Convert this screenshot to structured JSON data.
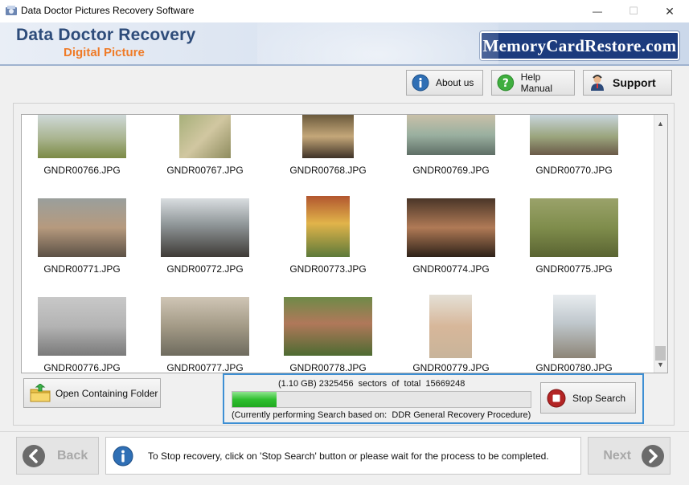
{
  "window": {
    "title": "Data Doctor Pictures Recovery Software",
    "minimize_glyph": "—",
    "maximize_glyph": "☐",
    "close_glyph": "✕"
  },
  "header": {
    "brand_main": "Data Doctor Recovery",
    "brand_sub": "Digital Picture",
    "site": "MemoryCardRestore.com",
    "colors": {
      "brand_blue": "#2e4c7a",
      "brand_orange": "#ef7b28",
      "badge_bg": "#1c3b7d"
    }
  },
  "toolbar": {
    "about_label": "About us",
    "help_label": "Help Manual",
    "support_label": "Support"
  },
  "gallery": {
    "items": [
      "GNDR00766.JPG",
      "GNDR00767.JPG",
      "GNDR00768.JPG",
      "GNDR00769.JPG",
      "GNDR00770.JPG",
      "GNDR00771.JPG",
      "GNDR00772.JPG",
      "GNDR00773.JPG",
      "GNDR00774.JPG",
      "GNDR00775.JPG",
      "GNDR00776.JPG",
      "GNDR00777.JPG",
      "GNDR00778.JPG",
      "GNDR00779.JPG",
      "GNDR00780.JPG"
    ]
  },
  "actions": {
    "open_folder_label": "Open Containing Folder",
    "stop_label": "Stop Search"
  },
  "progress": {
    "sectors_text": "(1.10 GB) 2325456  sectors  of  total  15669248",
    "status_text": "(Currently performing Search based on:  DDR General Recovery Procedure)",
    "fraction": 0.148
  },
  "footer": {
    "back_label": "Back",
    "next_label": "Next",
    "info_text": "To Stop recovery, click on 'Stop Search' button or please wait for the process to be completed."
  }
}
